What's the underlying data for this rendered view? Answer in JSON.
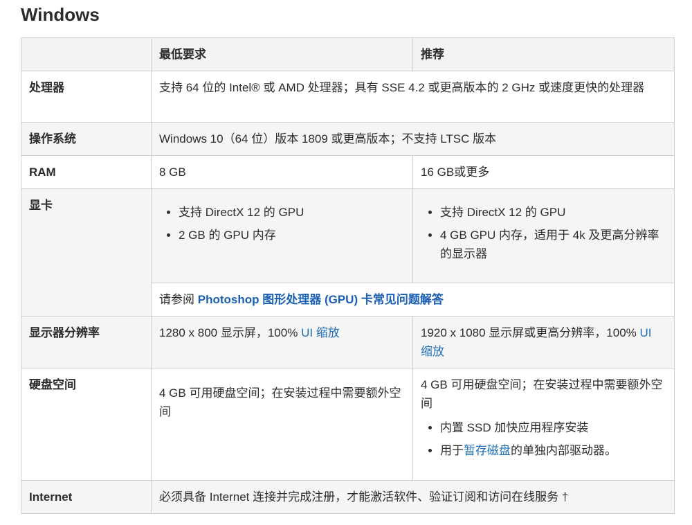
{
  "title": "Windows",
  "header": {
    "blank": "",
    "min": "最低要求",
    "rec": "推荐"
  },
  "rows": {
    "cpu": {
      "label": "处理器",
      "value": "支持 64 位的 Intel® 或 AMD 处理器；具有 SSE 4.2 或更高版本的 2 GHz 或速度更快的处理器"
    },
    "os": {
      "label": "操作系统",
      "value": "Windows 10（64 位）版本 1809 或更高版本；不支持 LTSC 版本"
    },
    "ram": {
      "label": "RAM",
      "min": "8 GB",
      "rec": "16 GB或更多"
    },
    "gpu": {
      "label": "显卡",
      "min_items": [
        "支持 DirectX 12 的 GPU",
        "2 GB 的 GPU 内存"
      ],
      "rec_items": [
        "支持 DirectX 12 的 GPU",
        "4 GB GPU 内存，适用于 4k 及更高分辨率的显示器"
      ],
      "see_prefix": "请参阅 ",
      "see_link": "Photoshop 图形处理器 (GPU) 卡常见问题解答"
    },
    "display": {
      "label": "显示器分辨率",
      "min_text": "1280 x 800 显示屏，100% ",
      "min_link": "UI 缩放",
      "rec_text": "1920 x 1080 显示屏或更高分辨率，100% ",
      "rec_link": "UI 缩放"
    },
    "disk": {
      "label": "硬盘空间",
      "min": "4 GB 可用硬盘空间；在安装过程中需要额外空间",
      "rec": "4 GB 可用硬盘空间；在安装过程中需要额外空间",
      "rec_item1": "内置 SSD 加快应用程序安装",
      "rec_item2_prefix": "用于",
      "rec_item2_link": "暂存磁盘",
      "rec_item2_suffix": "的单独内部驱动器。"
    },
    "internet": {
      "label": "Internet",
      "value": "必须具备 Internet 连接并完成注册，才能激活软件、验证订阅和访问在线服务 †"
    }
  }
}
